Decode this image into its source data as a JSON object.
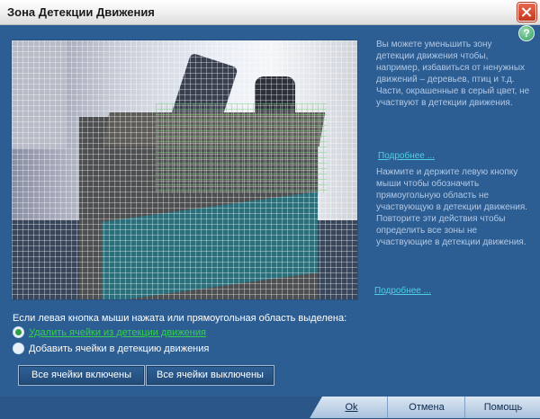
{
  "window": {
    "title": "Зона Детекции Движения"
  },
  "help": {
    "icon": "help-icon",
    "label": "?"
  },
  "info": {
    "text1": "Вы можете уменьшить зону детекции движения чтобы, например, избавиться от ненужных движений – деревьев, птиц и т.д. Части, окрашенные в серый цвет, не участвуют в детекции движения.",
    "link1": "Подробнее ...",
    "text2": "Нажмите и держите левую кнопку мыши чтобы обозначить прямоугольную область не участвующую в детекции движения. Повторите эти действия чтобы определить все зоны не участвующие в детекции движения.",
    "link2": "Подробнее ..."
  },
  "mode": {
    "hint": "Если левая кнопка мыши нажата или прямоугольная область выделена:",
    "options": [
      {
        "label": "Удалить ячейки из детекции движения",
        "selected": true
      },
      {
        "label": "Добавить ячейки в детекцию движения",
        "selected": false
      }
    ]
  },
  "buttons": {
    "all_on": "Все ячейки включены",
    "all_off": "Все ячейки выключены"
  },
  "footer": {
    "ok": "Ok",
    "cancel": "Отмена",
    "help": "Помощь"
  },
  "colors": {
    "background": "#2c5d93",
    "link": "#4fd0e0",
    "selected_option": "#34d04a"
  }
}
